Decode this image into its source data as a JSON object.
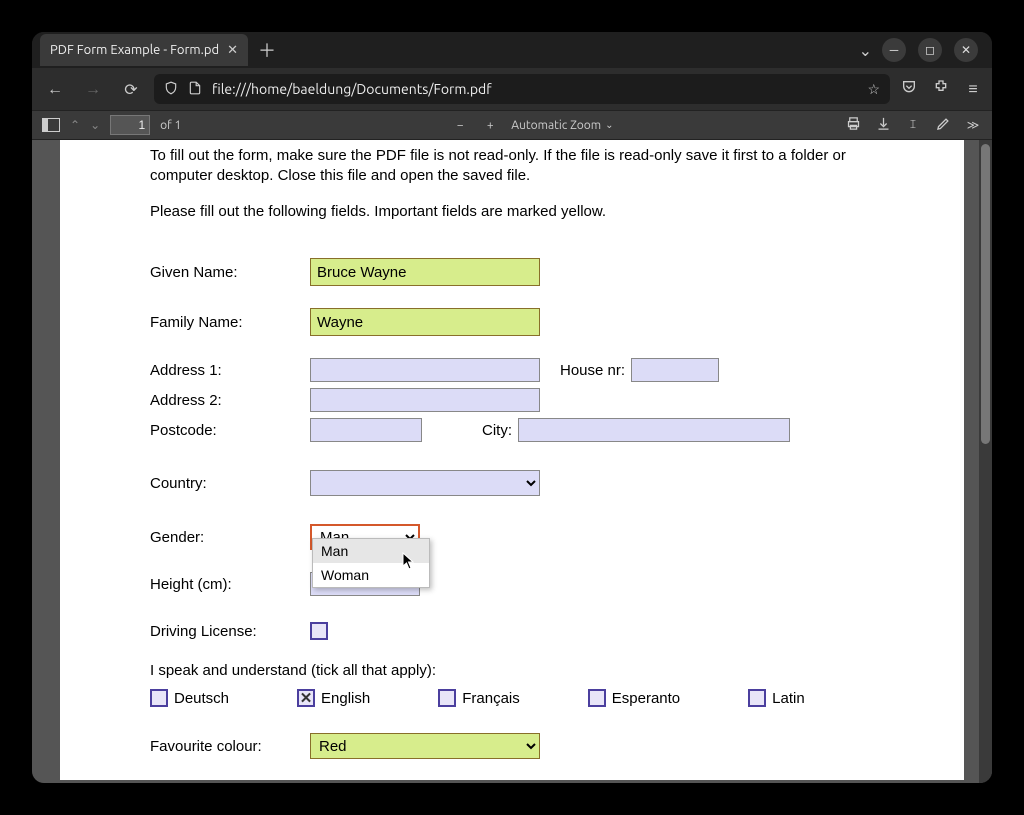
{
  "tab": {
    "title": "PDF Form Example - Form.pd"
  },
  "url": "file:///home/baeldung/Documents/Form.pdf",
  "pdfbar": {
    "page": "1",
    "page_of": "of 1",
    "zoom": "Automatic Zoom"
  },
  "doc": {
    "instr1": "To fill out the form, make sure the PDF file is not read-only. If the file is read-only save it first to a folder or computer desktop. Close this file and open the saved file.",
    "instr2": "Please fill out the following fields. Important fields are marked yellow.",
    "labels": {
      "given_name": "Given Name:",
      "family_name": "Family Name:",
      "address1": "Address 1:",
      "house_nr": "House nr:",
      "address2": "Address 2:",
      "postcode": "Postcode:",
      "city": "City:",
      "country": "Country:",
      "gender": "Gender:",
      "height": "Height (cm):",
      "driving": "Driving License:",
      "lang_head": "I speak and understand (tick all that apply):",
      "fav_colour": "Favourite colour:"
    },
    "values": {
      "given_name": "Bruce Wayne",
      "family_name": "Wayne",
      "gender_selected": "Man",
      "fav_colour": "Red"
    },
    "gender_options": {
      "opt1": "Man",
      "opt2": "Woman"
    },
    "languages": {
      "de": "Deutsch",
      "en": "English",
      "fr": "Français",
      "eo": "Esperanto",
      "la": "Latin"
    },
    "checks": {
      "en": "✕"
    }
  }
}
